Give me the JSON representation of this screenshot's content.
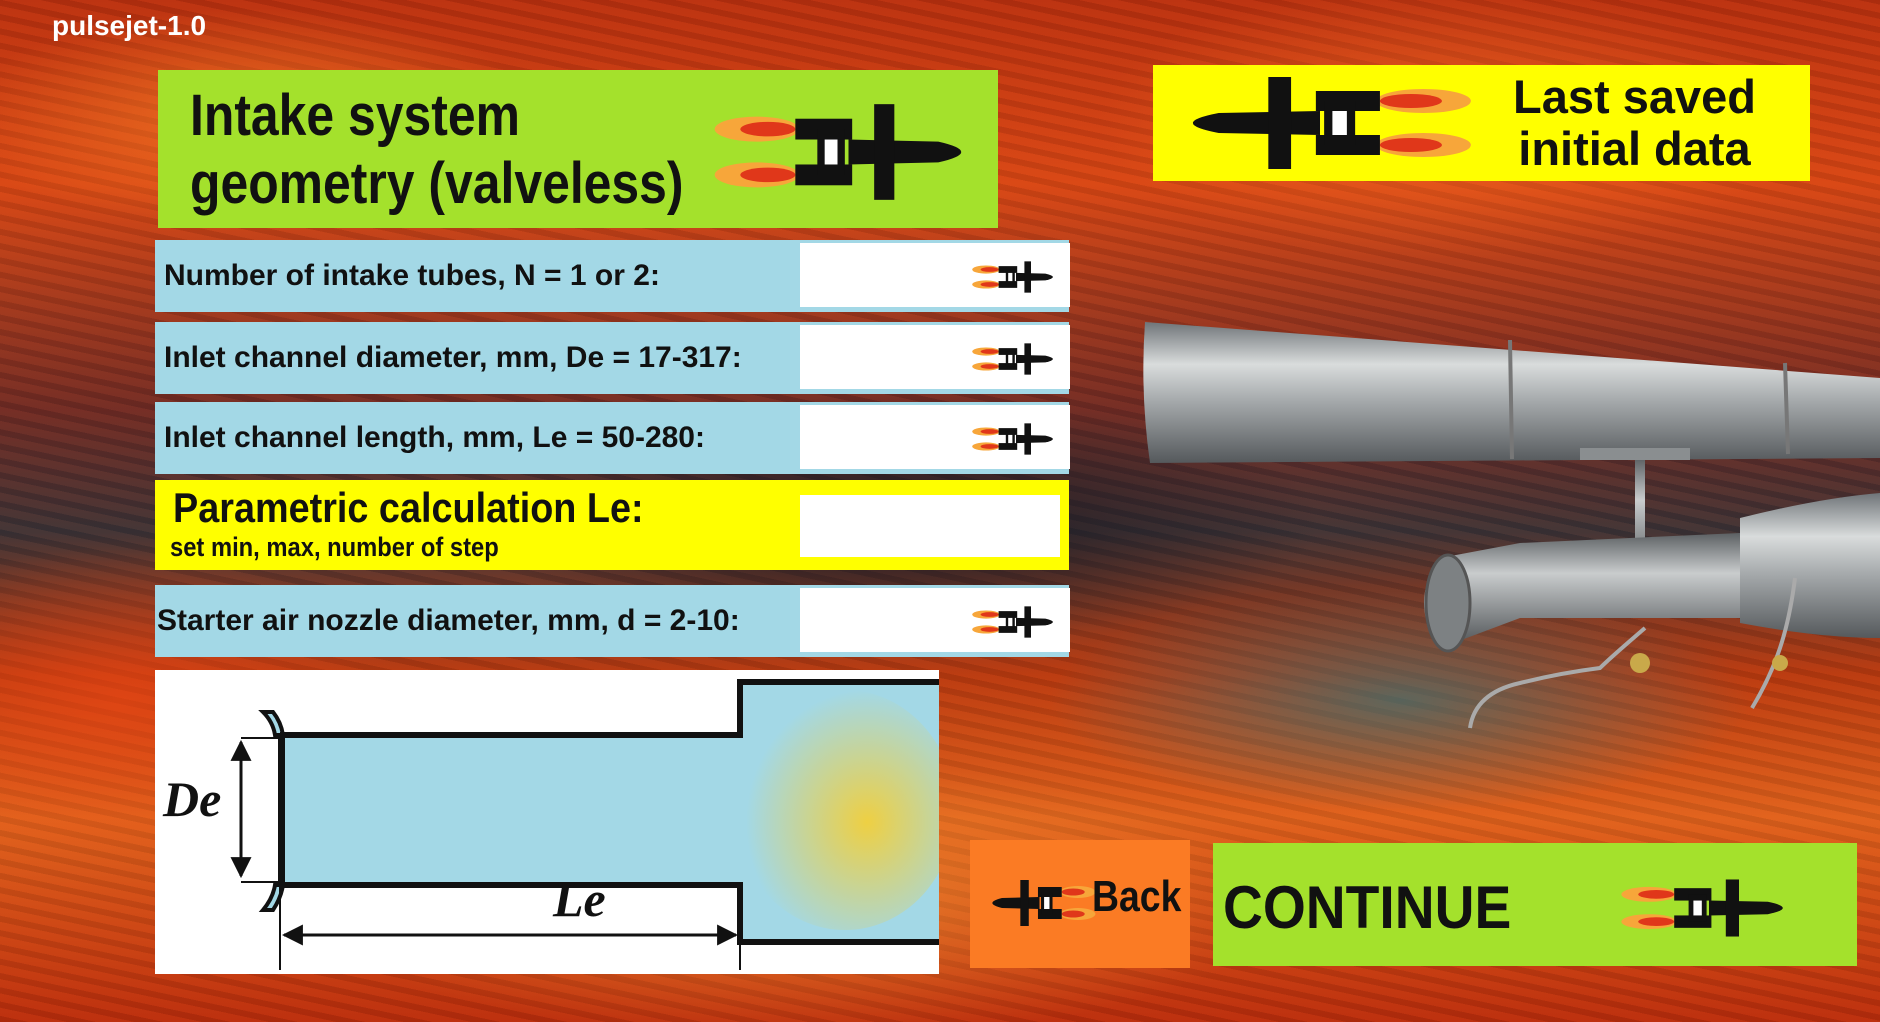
{
  "app": {
    "title": "pulsejet-1.0"
  },
  "header": {
    "title": "Intake system\ngeometry (valveless)"
  },
  "last_saved": {
    "label": "Last saved\ninitial data"
  },
  "params": [
    {
      "label": "Number of intake tubes, N = 1 or 2:",
      "value": ""
    },
    {
      "label": "Inlet channel diameter, mm, De = 17-317:",
      "value": ""
    },
    {
      "label": "Inlet channel length, mm, Le = 50-280:",
      "value": ""
    }
  ],
  "param_calc": {
    "title": "Parametric calculation Le:",
    "subtitle": "set min, max, number of step",
    "value": ""
  },
  "starter": {
    "label": "Starter air nozzle diameter, mm, d = 2-10:",
    "value": ""
  },
  "diagram": {
    "de_label": "De",
    "le_label": "Le"
  },
  "buttons": {
    "back_label": "Back",
    "continue_label": "CONTINUE"
  },
  "icons": {
    "header": "pulsejet-icon",
    "last_saved": "pulsejet-icon",
    "param": "pulsejet-icon",
    "back": "pulsejet-icon",
    "continue": "pulsejet-icon"
  },
  "colors": {
    "green_panel": "#a4e12c",
    "yellow_panel": "#ffff00",
    "blue_row": "#a3d8e6",
    "orange_button": "#fb7b24",
    "flame_red": "#e0371a",
    "flame_orange": "#f7a63a"
  }
}
